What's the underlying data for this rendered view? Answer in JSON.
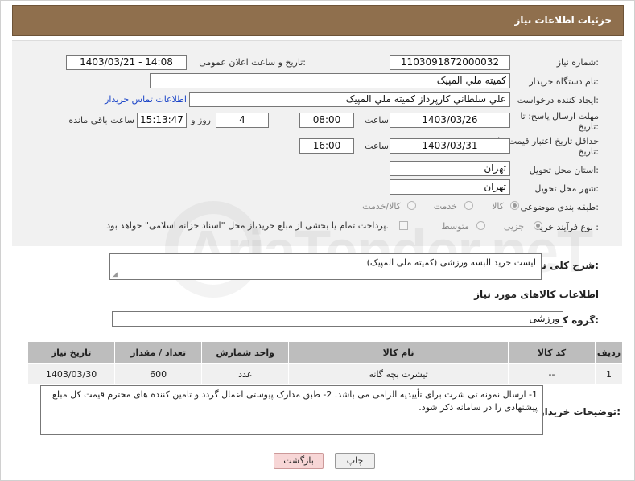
{
  "header": {
    "title": "جزئیات اطلاعات نیاز"
  },
  "fields": {
    "need_number_label": "شماره نیاز:",
    "need_number": "1103091872000032",
    "announce_label": "تاریخ و ساعت اعلان عمومی:",
    "announce_value": "1403/03/21 - 14:08",
    "buyer_org_label": "نام دستگاه خریدار:",
    "buyer_org": "كميته ملي المپيک",
    "requester_label": "ایجاد کننده درخواست:",
    "requester": "علي سلطاني کارپرداز کميته ملي المپيک",
    "contact_link": "اطلاعات تماس خریدار",
    "reply_deadline_label": "مهلت ارسال پاسخ: تا",
    "reply_deadline_label2": "تاریخ:",
    "reply_date": "1403/03/26",
    "time_label": "ساعت",
    "reply_time": "08:00",
    "days_value": "4",
    "days_label": "روز و",
    "remaining_time": "15:13:47",
    "remaining_label": "ساعت باقی مانده",
    "price_validity_label": "حداقل تاریخ اعتبار قیمت: تا",
    "price_validity_label2": "تاریخ:",
    "validity_date": "1403/03/31",
    "validity_time": "16:00",
    "province_label": "استان محل تحویل:",
    "province": "تهران",
    "city_label": "شهر محل تحویل:",
    "city": "تهران",
    "category_label": "طبقه بندی موضوعی:",
    "category_options": [
      "کالا",
      "خدمت",
      "کالا/خدمت"
    ],
    "process_label": "نوع فرآیند خرید :",
    "process_options": [
      "جزیی",
      "متوسط"
    ],
    "payment_note": "پرداخت تمام یا بخشی از مبلغ خرید،از محل \"اسناد خزانه اسلامی\" خواهد بود."
  },
  "description": {
    "label": "شرح کلی نیاز:",
    "value": "لیست خرید البسه ورزشی (کمیته ملی المپیک)"
  },
  "goods_section": {
    "title": "اطلاعات کالاهای مورد نیاز",
    "group_label": "گروه کالا:",
    "group_value": "ورزشی"
  },
  "table": {
    "headers": [
      "ردیف",
      "کد کالا",
      "نام کالا",
      "واحد شمارش",
      "تعداد / مقدار",
      "تاریخ نیاز"
    ],
    "rows": [
      [
        "1",
        "--",
        "تیشرت بچه گانه",
        "عدد",
        "600",
        "1403/03/30"
      ]
    ]
  },
  "buyer_notes": {
    "label": "توضیحات خریدار:",
    "value": "1- ارسال نمونه تی شرت برای تأییدیه الزامی می باشد. 2- طبق مدارک پیوستی اعمال گردد و تامین کننده های محترم قیمت کل مبلغ پیشنهادی را در سامانه ذکر شود."
  },
  "buttons": {
    "print": "چاپ",
    "back": "بازگشت"
  },
  "watermark": "AriaTender.neT"
}
